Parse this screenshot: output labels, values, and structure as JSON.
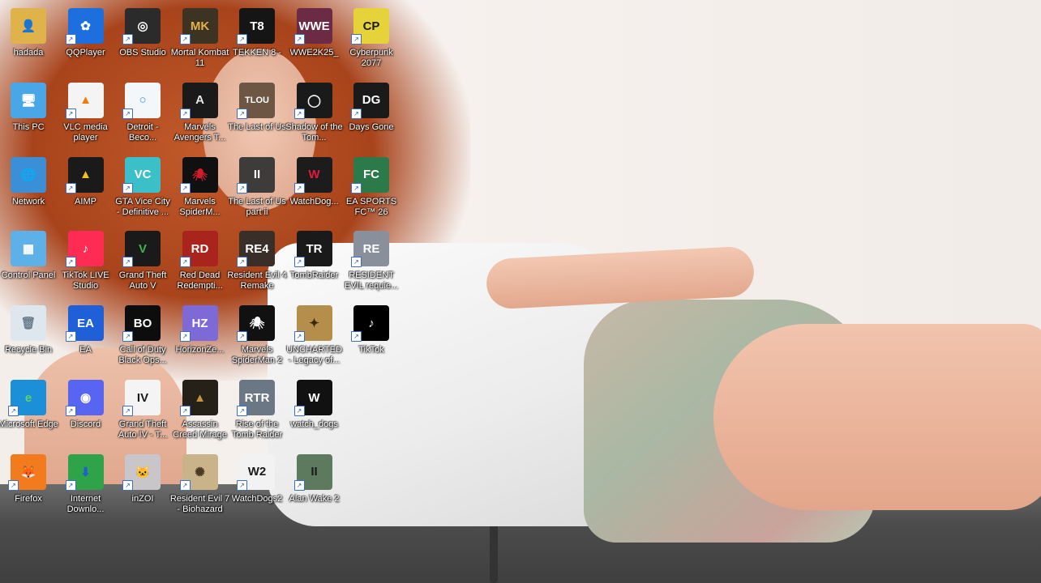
{
  "desktop": {
    "icons": [
      {
        "label": "hadada",
        "icon": "folder-user-icon",
        "bg": "#e0b24a",
        "fg": "#2d6a2d",
        "glyph": "👤",
        "shortcut": false
      },
      {
        "label": "This PC",
        "icon": "computer-icon",
        "bg": "#49a7e8",
        "fg": "#ffffff",
        "glyph": "🖥",
        "shortcut": false
      },
      {
        "label": "Network",
        "icon": "network-icon",
        "bg": "#3b8fd6",
        "fg": "#ffffff",
        "glyph": "🌐",
        "shortcut": false
      },
      {
        "label": "Control Panel",
        "icon": "control-panel-icon",
        "bg": "#5db1e8",
        "fg": "#ffffff",
        "glyph": "▦",
        "shortcut": false
      },
      {
        "label": "Recycle Bin",
        "icon": "recycle-bin-icon",
        "bg": "#dfe7ee",
        "fg": "#6a7c8c",
        "glyph": "🗑",
        "shortcut": false
      },
      {
        "label": "Microsoft Edge",
        "icon": "edge-icon",
        "bg": "#1b8fd8",
        "fg": "#5ed36a",
        "glyph": "e",
        "shortcut": true
      },
      {
        "label": "Firefox",
        "icon": "firefox-icon",
        "bg": "#f27b1e",
        "fg": "#7a2fbf",
        "glyph": "🦊",
        "shortcut": true
      },
      {
        "label": "QQPlayer",
        "icon": "qqplayer-icon",
        "bg": "#1d6fe0",
        "fg": "#ffffff",
        "glyph": "✿",
        "shortcut": true
      },
      {
        "label": "VLC media player",
        "icon": "vlc-icon",
        "bg": "#f4f4f4",
        "fg": "#f07b0c",
        "glyph": "▲",
        "shortcut": true
      },
      {
        "label": "AIMP",
        "icon": "aimp-icon",
        "bg": "#1a1a1a",
        "fg": "#f2c21b",
        "glyph": "▲",
        "shortcut": true
      },
      {
        "label": "TikTok LIVE Studio",
        "icon": "tiktok-live-icon",
        "bg": "#fe2c55",
        "fg": "#ffffff",
        "glyph": "♪",
        "shortcut": true
      },
      {
        "label": "EA",
        "icon": "ea-icon",
        "bg": "#1f5fd8",
        "fg": "#ffffff",
        "glyph": "EA",
        "shortcut": true
      },
      {
        "label": "Discord",
        "icon": "discord-icon",
        "bg": "#5865f2",
        "fg": "#ffffff",
        "glyph": "◉",
        "shortcut": true
      },
      {
        "label": "Internet Downlo...",
        "icon": "idm-icon",
        "bg": "#2ea34a",
        "fg": "#1c5fcf",
        "glyph": "⬇",
        "shortcut": true
      },
      {
        "label": "OBS Studio",
        "icon": "obs-icon",
        "bg": "#2b2b2b",
        "fg": "#ffffff",
        "glyph": "◎",
        "shortcut": true
      },
      {
        "label": "Detroit - Beco...",
        "icon": "detroit-icon",
        "bg": "#f4f7fa",
        "fg": "#2d8fd8",
        "glyph": "○",
        "shortcut": true
      },
      {
        "label": "GTA Vice City - Definitive ...",
        "icon": "gta-vice-city-icon",
        "bg": "#3bbfc9",
        "fg": "#ffffff",
        "glyph": "VC",
        "shortcut": true
      },
      {
        "label": "Grand Theft Auto V",
        "icon": "gta-v-icon",
        "bg": "#1a1a1a",
        "fg": "#3fb34a",
        "glyph": "V",
        "shortcut": true
      },
      {
        "label": "Call of Duty Black Ops...",
        "icon": "black-ops-icon",
        "bg": "#0d0d0d",
        "fg": "#ffffff",
        "glyph": "BO",
        "shortcut": true
      },
      {
        "label": "Grand Theft Auto IV - T...",
        "icon": "gta-iv-icon",
        "bg": "#f4f4f4",
        "fg": "#1a1a1a",
        "glyph": "IV",
        "shortcut": true
      },
      {
        "label": "inZOI",
        "icon": "inzoi-icon",
        "bg": "#c9c6c9",
        "fg": "#ffffff",
        "glyph": "🐱",
        "shortcut": true
      },
      {
        "label": "Mortal Kombat 11",
        "icon": "mortal-kombat-icon",
        "bg": "#3d3322",
        "fg": "#e3b34a",
        "glyph": "MK",
        "shortcut": true
      },
      {
        "label": "Marvels Avengers T...",
        "icon": "avengers-icon",
        "bg": "#1a1a1a",
        "fg": "#e9e9e9",
        "glyph": "A",
        "shortcut": true
      },
      {
        "label": "Marvels SpiderM...",
        "icon": "spiderman-icon",
        "bg": "#101010",
        "fg": "#d21d2a",
        "glyph": "🕷",
        "shortcut": true
      },
      {
        "label": "Red Dead Redempti...",
        "icon": "red-dead-icon",
        "bg": "#a8241d",
        "fg": "#ffffff",
        "glyph": "RD",
        "shortcut": true
      },
      {
        "label": "HorizonZe...",
        "icon": "horizon-icon",
        "bg": "#7d6ad6",
        "fg": "#ffffff",
        "glyph": "HZ",
        "shortcut": true
      },
      {
        "label": "Assassin Creed Mirage",
        "icon": "assassins-creed-icon",
        "bg": "#262118",
        "fg": "#c7963c",
        "glyph": "▲",
        "shortcut": true
      },
      {
        "label": "Resident Evil 7 - Biohazard",
        "icon": "resident-evil-7-icon",
        "bg": "#c9b48a",
        "fg": "#4a3a20",
        "glyph": "✺",
        "shortcut": true
      },
      {
        "label": "TEKKEN 8 -",
        "icon": "tekken-icon",
        "bg": "#151515",
        "fg": "#ffffff",
        "glyph": "T8",
        "shortcut": true
      },
      {
        "label": "The Last of Us",
        "icon": "last-of-us-icon",
        "bg": "#6d5744",
        "fg": "#ffffff",
        "glyph": "TLOU",
        "shortcut": true
      },
      {
        "label": "The Last of Us part ii",
        "icon": "last-of-us-2-icon",
        "bg": "#3e3b3b",
        "fg": "#ffffff",
        "glyph": "II",
        "shortcut": true
      },
      {
        "label": "Resident Evil 4 Remake",
        "icon": "resident-evil-4-icon",
        "bg": "#3a2e28",
        "fg": "#ffffff",
        "glyph": "RE4",
        "shortcut": true
      },
      {
        "label": "Marvels SpiderMan 2",
        "icon": "spiderman-2-icon",
        "bg": "#111111",
        "fg": "#ffffff",
        "glyph": "🕷",
        "shortcut": true
      },
      {
        "label": "Rise of the Tomb Raider",
        "icon": "rise-tomb-raider-icon",
        "bg": "#6b7785",
        "fg": "#ffffff",
        "glyph": "RTR",
        "shortcut": true
      },
      {
        "label": "WatchDogs2",
        "icon": "watchdogs2-icon",
        "bg": "#f2f2f2",
        "fg": "#1a1a1a",
        "glyph": "W2",
        "shortcut": true
      },
      {
        "label": "WWE2K25_",
        "icon": "wwe-icon",
        "bg": "#6b2b45",
        "fg": "#ffffff",
        "glyph": "WWE",
        "shortcut": true
      },
      {
        "label": "Shadow of the Tom...",
        "icon": "shadow-tomb-raider-icon",
        "bg": "#1a1a1a",
        "fg": "#f2f2f2",
        "glyph": "◯",
        "shortcut": true
      },
      {
        "label": "WatchDog...",
        "icon": "watchdog-icon",
        "bg": "#1c1c1c",
        "fg": "#e01b3c",
        "glyph": "W",
        "shortcut": true
      },
      {
        "label": "TombRaider",
        "icon": "tomb-raider-icon",
        "bg": "#1a1a1a",
        "fg": "#ffffff",
        "glyph": "TR",
        "shortcut": true
      },
      {
        "label": "UNCHARTED - Legacy of...",
        "icon": "uncharted-icon",
        "bg": "#b48e4a",
        "fg": "#3a2a10",
        "glyph": "✦",
        "shortcut": true
      },
      {
        "label": "watch_dogs",
        "icon": "watch-dogs-icon",
        "bg": "#111111",
        "fg": "#ffffff",
        "glyph": "W",
        "shortcut": true
      },
      {
        "label": "Alan Wake 2",
        "icon": "alan-wake-icon",
        "bg": "#5e7a5e",
        "fg": "#1a1a1a",
        "glyph": "II",
        "shortcut": true
      },
      {
        "label": "Cyberpunk 2077",
        "icon": "cyberpunk-icon",
        "bg": "#e6d33a",
        "fg": "#1a1a1a",
        "glyph": "CP",
        "shortcut": true
      },
      {
        "label": "Days Gone",
        "icon": "days-gone-icon",
        "bg": "#1a1a1a",
        "fg": "#ffffff",
        "glyph": "DG",
        "shortcut": true
      },
      {
        "label": "EA SPORTS FC™ 26",
        "icon": "ea-fc-icon",
        "bg": "#2c7a4a",
        "fg": "#ffffff",
        "glyph": "FC",
        "shortcut": true
      },
      {
        "label": "RESIDENT EVIL requie...",
        "icon": "resident-evil-requiem-icon",
        "bg": "#8a8f9c",
        "fg": "#ffffff",
        "glyph": "RE",
        "shortcut": true
      },
      {
        "label": "TikTok",
        "icon": "tiktok-icon",
        "bg": "#000000",
        "fg": "#ffffff",
        "glyph": "♪",
        "shortcut": true
      }
    ]
  }
}
